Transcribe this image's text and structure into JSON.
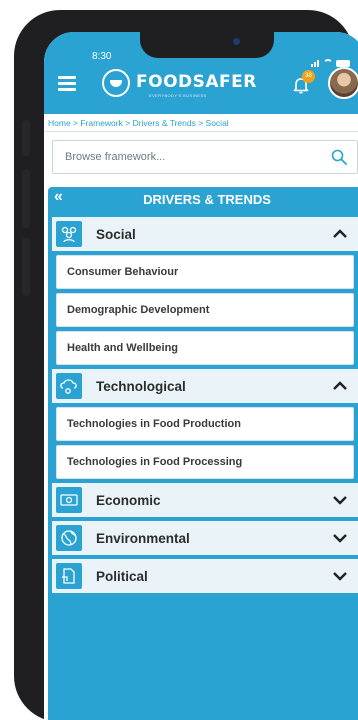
{
  "status": {
    "time": "8:30"
  },
  "header": {
    "brand": "FOODSAFER",
    "brand_sub": "EVERYBODY'S BUSINESS",
    "notification_count": "38"
  },
  "breadcrumb": "Home > Framework > Drivers & Trends > Social",
  "search": {
    "placeholder": "Browse framework..."
  },
  "panel": {
    "back": "«",
    "title": "DRIVERS & TRENDS",
    "categories": [
      {
        "label": "Social",
        "expanded": true,
        "icon": "people-icon",
        "items": [
          "Consumer Behaviour",
          "Demographic Development",
          "Health and Wellbeing"
        ]
      },
      {
        "label": "Technological",
        "expanded": true,
        "icon": "cloud-gear-icon",
        "items": [
          "Technologies in Food Production",
          "Technologies in Food Processing"
        ]
      },
      {
        "label": "Economic",
        "expanded": false,
        "icon": "money-icon",
        "items": []
      },
      {
        "label": "Environmental",
        "expanded": false,
        "icon": "globe-icon",
        "items": []
      },
      {
        "label": "Political",
        "expanded": false,
        "icon": "document-icon",
        "items": []
      }
    ]
  },
  "colors": {
    "accent": "#2aa3d2",
    "badge": "#f1a21a",
    "category_bg": "#eaf4f8"
  }
}
